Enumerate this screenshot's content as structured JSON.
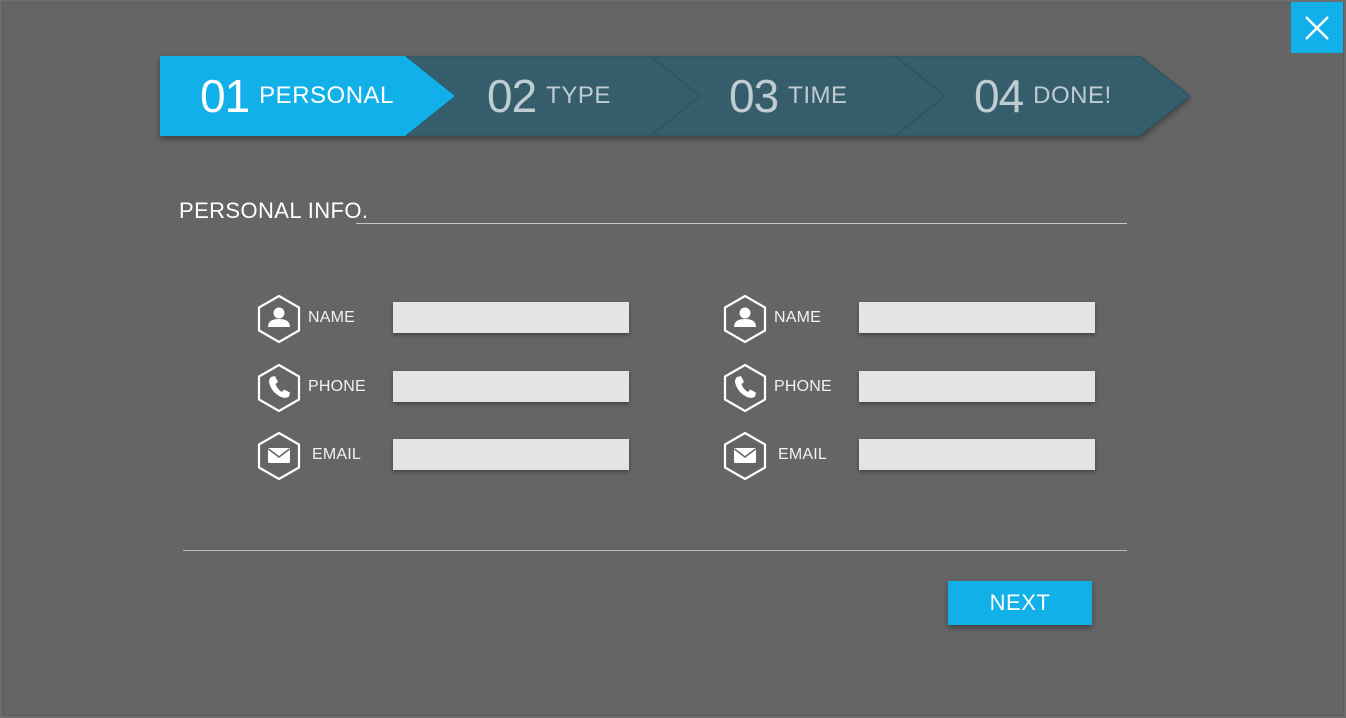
{
  "close_button": {
    "icon": "close-icon"
  },
  "steps": [
    {
      "num": "01",
      "label": "PERSONAL",
      "active": true
    },
    {
      "num": "02",
      "label": "TYPE",
      "active": false
    },
    {
      "num": "03",
      "label": "TIME",
      "active": false
    },
    {
      "num": "04",
      "label": "DONE!",
      "active": false
    }
  ],
  "section": {
    "title": "PERSONAL INFO."
  },
  "left_form": {
    "name_label": "NAME",
    "phone_label": "PHONE",
    "email_label": "EMAIL",
    "name_value": "",
    "phone_value": "",
    "email_value": ""
  },
  "right_form": {
    "name_label": "NAME",
    "phone_label": "PHONE",
    "email_label": "EMAIL",
    "name_value": "",
    "phone_value": "",
    "email_value": ""
  },
  "footer": {
    "next_label": "NEXT"
  },
  "colors": {
    "accent": "#12b0e8",
    "step_inactive": "#365d6b",
    "background": "#656565",
    "input": "#e4e4e4"
  }
}
